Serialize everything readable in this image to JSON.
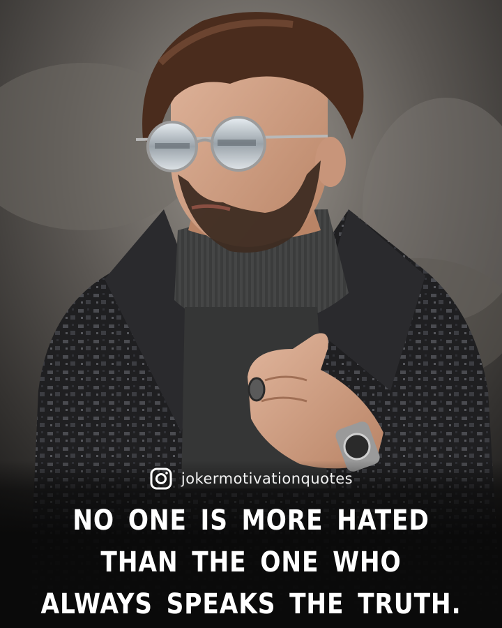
{
  "social": {
    "icon": "instagram-icon",
    "handle": "jokermotivationquotes"
  },
  "quote": {
    "lines": [
      "NO ONE IS MORE HATED",
      "THAN THE ONE WHO",
      "ALWAYS SPEAKS THE TRUTH."
    ]
  },
  "colors": {
    "text": "#ffffff",
    "caption_background": "#0a0a0a"
  }
}
